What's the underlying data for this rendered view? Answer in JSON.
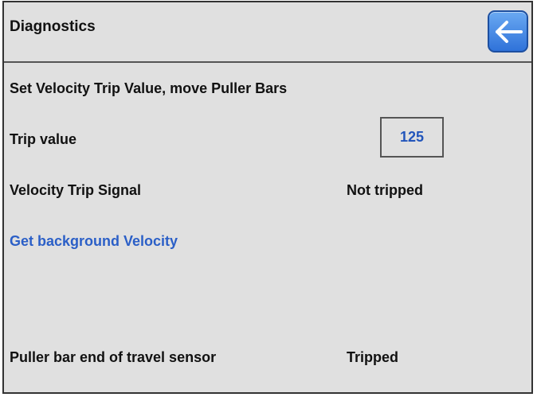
{
  "header": {
    "title": "Diagnostics",
    "back_icon": "arrow-left-icon"
  },
  "main": {
    "instruction": "Set Velocity Trip Value, move Puller Bars",
    "trip": {
      "label": "Trip value",
      "value": "125"
    },
    "velocity_signal": {
      "label": "Velocity Trip Signal",
      "status": "Not tripped"
    },
    "get_background_link": "Get background Velocity",
    "puller_sensor": {
      "label": "Puller bar end of travel sensor",
      "status": "Tripped"
    }
  },
  "colors": {
    "background": "#e0e0e0",
    "accent_blue": "#2b5fc7",
    "button_blue": "#2f72d9"
  }
}
